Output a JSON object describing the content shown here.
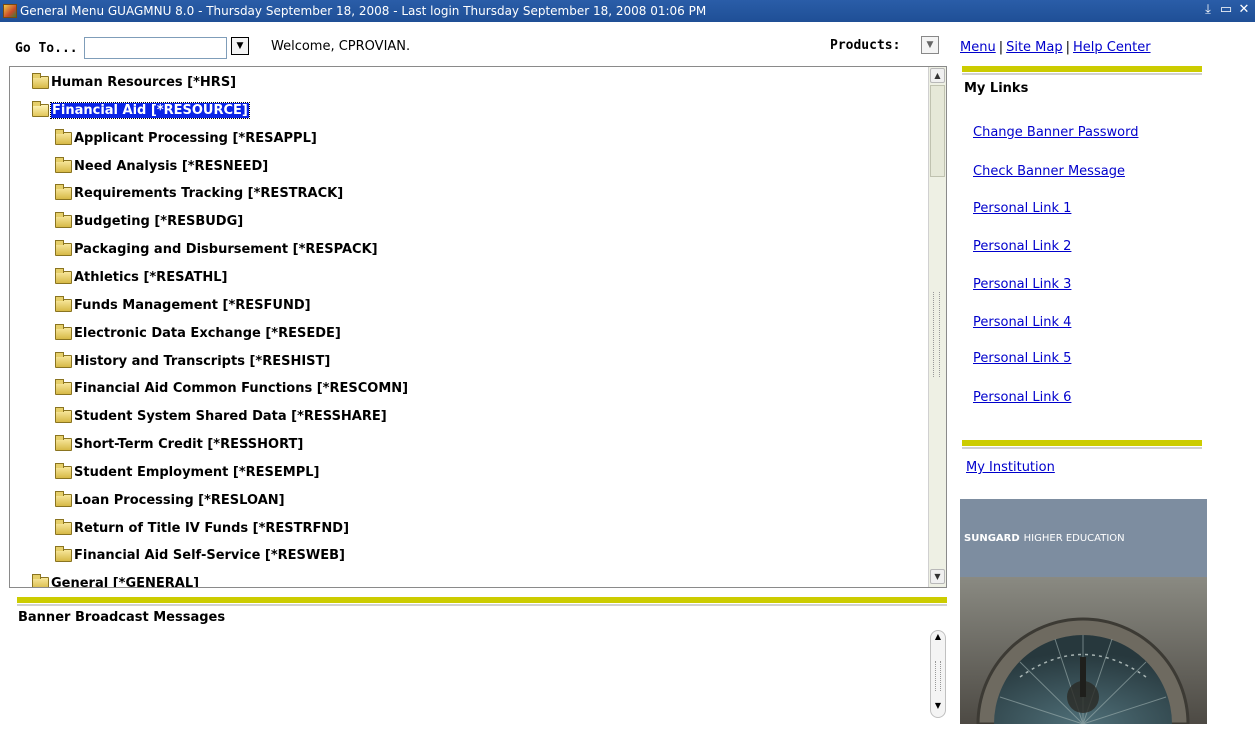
{
  "window": {
    "title": "General Menu  GUAGMNU  8.0 - Thursday September 18, 2008 - Last login Thursday September 18, 2008 01:06 PM",
    "controls": [
      "⤓",
      "▭",
      "✕"
    ]
  },
  "toolbar": {
    "goto_label": "Go To...",
    "goto_value": "",
    "welcome": "Welcome, CPROVIAN.",
    "products_label": "Products:"
  },
  "toplinks": {
    "menu": "Menu",
    "sitemap": "Site Map",
    "help": "Help Center",
    "separator": "|"
  },
  "tree": {
    "items": [
      {
        "label": "Human Resources [*HRS]",
        "level": 0,
        "open": false,
        "selected": false
      },
      {
        "label": "Financial Aid [*RESOURCE]",
        "level": 0,
        "open": true,
        "selected": true
      },
      {
        "label": "Applicant Processing [*RESAPPL]",
        "level": 1,
        "open": false,
        "selected": false
      },
      {
        "label": "Need Analysis [*RESNEED]",
        "level": 1,
        "open": false,
        "selected": false
      },
      {
        "label": "Requirements Tracking [*RESTRACK]",
        "level": 1,
        "open": false,
        "selected": false
      },
      {
        "label": "Budgeting [*RESBUDG]",
        "level": 1,
        "open": false,
        "selected": false
      },
      {
        "label": "Packaging and Disbursement [*RESPACK]",
        "level": 1,
        "open": false,
        "selected": false
      },
      {
        "label": "Athletics [*RESATHL]",
        "level": 1,
        "open": false,
        "selected": false
      },
      {
        "label": "Funds Management [*RESFUND]",
        "level": 1,
        "open": false,
        "selected": false
      },
      {
        "label": "Electronic Data Exchange [*RESEDE]",
        "level": 1,
        "open": false,
        "selected": false
      },
      {
        "label": "History and Transcripts [*RESHIST]",
        "level": 1,
        "open": false,
        "selected": false
      },
      {
        "label": "Financial Aid Common Functions [*RESCOMN]",
        "level": 1,
        "open": false,
        "selected": false
      },
      {
        "label": "Student System Shared Data [*RESSHARE]",
        "level": 1,
        "open": false,
        "selected": false
      },
      {
        "label": "Short-Term Credit [*RESSHORT]",
        "level": 1,
        "open": false,
        "selected": false
      },
      {
        "label": "Student Employment [*RESEMPL]",
        "level": 1,
        "open": false,
        "selected": false
      },
      {
        "label": "Loan Processing [*RESLOAN]",
        "level": 1,
        "open": false,
        "selected": false
      },
      {
        "label": "Return of Title IV Funds [*RESTRFND]",
        "level": 1,
        "open": false,
        "selected": false
      },
      {
        "label": "Financial Aid Self-Service [*RESWEB]",
        "level": 1,
        "open": false,
        "selected": false
      },
      {
        "label": "General [*GENERAL]",
        "level": 0,
        "open": false,
        "selected": false
      }
    ]
  },
  "broadcast": {
    "title": "Banner Broadcast Messages"
  },
  "mylinks": {
    "title": "My Links",
    "links": [
      "Change Banner Password",
      "Check Banner Message",
      "Personal Link 1",
      "Personal Link 2",
      "Personal Link 3",
      "Personal Link 4",
      "Personal Link 5",
      "Personal Link 6"
    ]
  },
  "institution": {
    "link": "My Institution"
  },
  "promo": {
    "brand": "SUNGARD",
    "tagline": "HIGHER EDUCATION"
  },
  "colors": {
    "titlebar": "#1f4f96",
    "accent_bar": "#cccc00",
    "link": "#0000cc",
    "selection": "#0a24e6"
  }
}
